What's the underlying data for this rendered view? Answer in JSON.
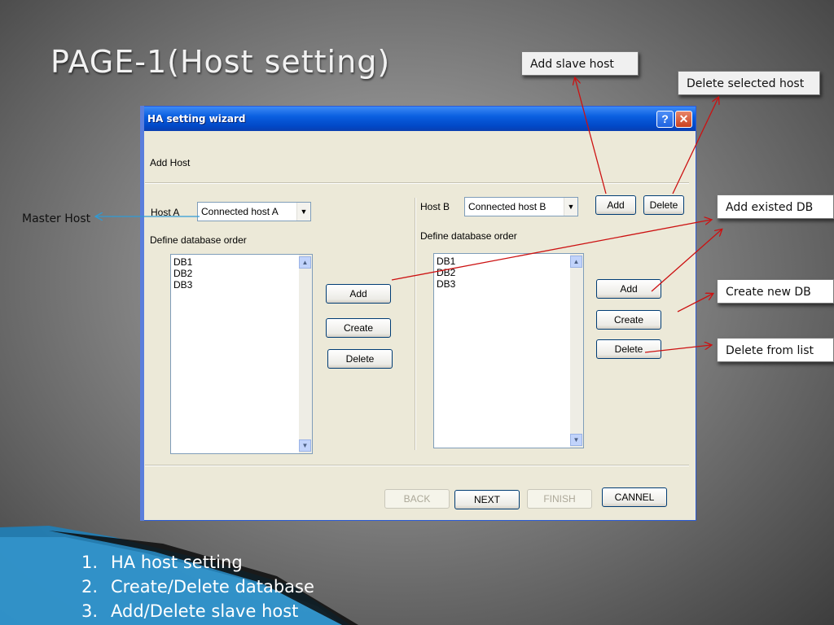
{
  "slide": {
    "title": "PAGE-1(Host setting)",
    "list": [
      {
        "num": "1.",
        "text": "HA host setting"
      },
      {
        "num": "2.",
        "text": "Create/Delete database"
      },
      {
        "num": "3.",
        "text": "Add/Delete slave host"
      }
    ]
  },
  "callouts": {
    "add_slave_host": "Add slave host",
    "delete_selected_host": "Delete selected host",
    "add_existed_db": "Add existed DB",
    "create_new_db": "Create new DB",
    "delete_from_list": "Delete from list",
    "master_host": "Master Host"
  },
  "dialog": {
    "title": "HA setting wizard",
    "help_glyph": "?",
    "close_glyph": "✕",
    "section_title": "Add Host",
    "host_a": {
      "label": "Host A",
      "value": "Connected host A",
      "define_label": "Define database order",
      "databases": [
        "DB1",
        "DB2",
        "DB3"
      ],
      "add_label": "Add",
      "create_label": "Create",
      "delete_label": "Delete"
    },
    "host_b": {
      "label": "Host B",
      "value": "Connected host B",
      "add_host_label": "Add",
      "delete_host_label": "Delete",
      "define_label": "Define database order",
      "databases": [
        "DB1",
        "DB2",
        "DB3"
      ],
      "add_label": "Add",
      "create_label": "Create",
      "delete_label": "Delete"
    },
    "footer": {
      "back_label": "BACK",
      "next_label": "NEXT",
      "finish_label": "FINISH",
      "cancel_label": "CANNEL"
    }
  },
  "colors": {
    "arrow": "#cc1111",
    "master_arrow": "#2e9bd6",
    "titlebar": "#0a5fe0"
  }
}
